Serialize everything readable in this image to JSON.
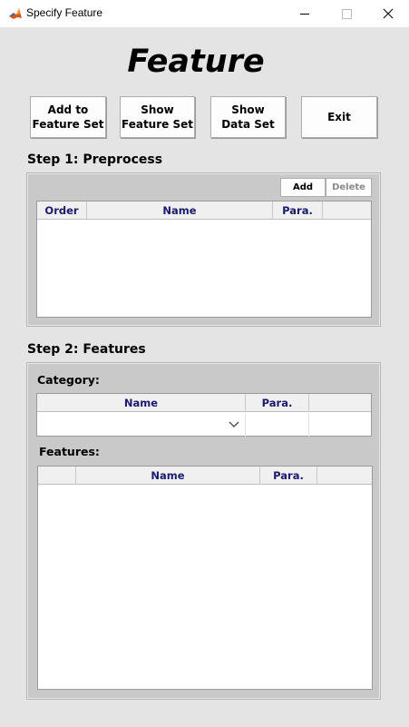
{
  "window": {
    "title": "Specify Feature",
    "controls": {
      "minimize": "minimize",
      "maximize": "maximize",
      "close": "×"
    }
  },
  "heading": "Feature",
  "toolbar": {
    "add_to_feature_set": "Add to\nFeature Set",
    "show_feature_set": "Show\nFeature Set",
    "show_data_set": "Show\nData Set",
    "exit": "Exit"
  },
  "step1": {
    "title": "Step 1: Preprocess",
    "add_label": "Add",
    "delete_label": "Delete",
    "columns": [
      "Order",
      "Name",
      "Para.",
      ""
    ],
    "rows": []
  },
  "step2": {
    "title": "Step 2: Features",
    "category_label": "Category:",
    "category_columns": [
      "Name",
      "Para.",
      ""
    ],
    "category_row": {
      "name": "",
      "para": "",
      "extra": ""
    },
    "features_label": "Features:",
    "features_columns": [
      "",
      "Name",
      "Para.",
      ""
    ],
    "rows": []
  },
  "colors": {
    "background": "#e4e4e4",
    "panel": "#c9c9c9",
    "header_text": "#1a1a6e",
    "disabled_text": "#8a8a8a",
    "matlab_icon_orange": "#d9531e"
  },
  "icons": {
    "app": "matlab-icon",
    "dropdown": "chevron-down-icon"
  }
}
